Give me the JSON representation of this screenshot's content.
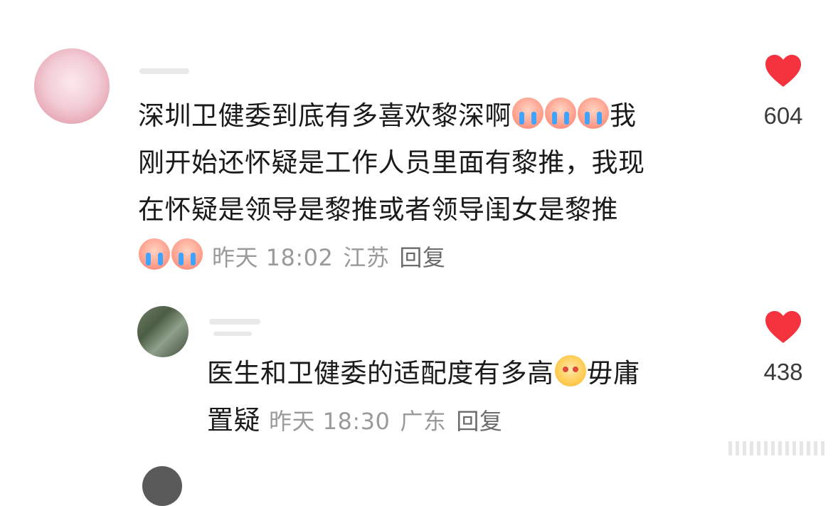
{
  "comments": [
    {
      "text_lines": [
        "深圳卫健委到底有多喜欢黎深啊",
        "我",
        "刚开始还怀疑是工作人员里面有黎推，我现",
        "在怀疑是领导是黎推或者领导闺女是黎推"
      ],
      "time": "昨天 18:02",
      "location": "江苏",
      "reply_label": "回复",
      "likes": "604",
      "trail_emoji": "crying-face",
      "end_emoji": "crying-face"
    },
    {
      "text_lines": [
        "医生和卫健委的适配度有多高",
        "毋庸",
        "置疑"
      ],
      "time": "昨天 18:30",
      "location": "广东",
      "reply_label": "回复",
      "likes": "438",
      "trail_emoji": "happy-face"
    }
  ],
  "colors": {
    "heart": "#f5333f",
    "meta_text": "#9a9a9a",
    "body_text": "#1a1a1a"
  },
  "icons": [
    "heart-icon",
    "crying-emoji-icon",
    "happy-emoji-icon"
  ]
}
